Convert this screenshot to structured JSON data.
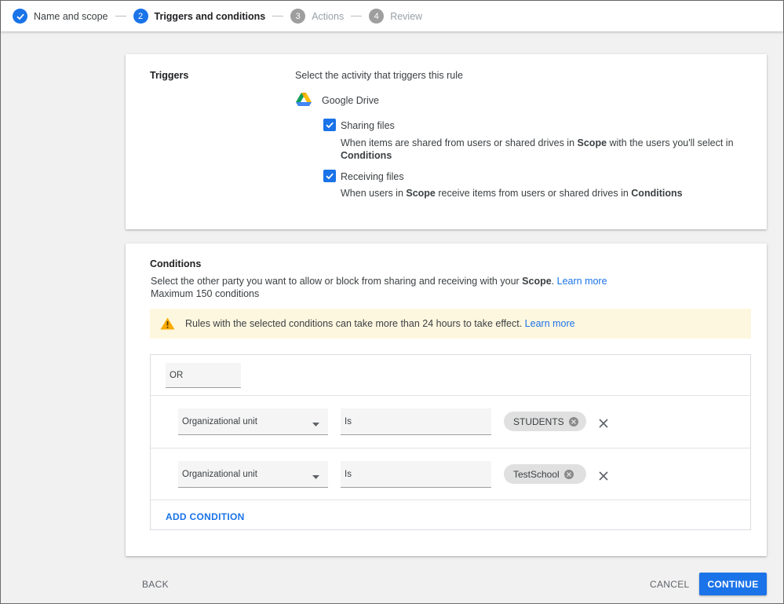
{
  "stepper": {
    "steps": [
      {
        "number": "",
        "label": "Name and scope",
        "state": "done"
      },
      {
        "number": "2",
        "label": "Triggers and conditions",
        "state": "active"
      },
      {
        "number": "3",
        "label": "Actions",
        "state": "upcoming"
      },
      {
        "number": "4",
        "label": "Review",
        "state": "upcoming"
      }
    ]
  },
  "triggers": {
    "section_title": "Triggers",
    "instruction": "Select the activity that triggers this rule",
    "app_name": "Google Drive",
    "app_icon": "google-drive-icon",
    "options": [
      {
        "label": "Sharing files",
        "checked": true,
        "desc_1": "When items are shared from users or shared drives in ",
        "desc_bold_1": "Scope",
        "desc_2": " with the users you'll select in",
        "desc_bold_2": "Conditions"
      },
      {
        "label": "Receiving files",
        "checked": true,
        "desc_1": "When users in ",
        "desc_bold_1": "Scope",
        "desc_2": " receive items from users or shared drives in ",
        "desc_bold_2": "Conditions"
      }
    ]
  },
  "conditions": {
    "section_title": "Conditions",
    "desc_1": "Select the other party you want to allow or block from sharing and receiving with your ",
    "desc_bold": "Scope",
    "desc_2": ". ",
    "learn_more": "Learn more",
    "max_text": "Maximum 150 conditions",
    "warning_text": "Rules with the selected conditions can take more than 24 hours to take effect. ",
    "warning_link": "Learn more",
    "operator": "OR",
    "rows": [
      {
        "field": "Organizational unit",
        "op": "Is",
        "chip": "STUDENTS"
      },
      {
        "field": "Organizational unit",
        "op": "Is",
        "chip": "TestSchool"
      }
    ],
    "add_condition": "ADD CONDITION"
  },
  "footer": {
    "back": "BACK",
    "cancel": "CANCEL",
    "continue": "CONTINUE"
  },
  "colors": {
    "accent": "#1a73e8",
    "warning_bg": "#fef7e0",
    "warning_icon": "#f9ab00"
  }
}
